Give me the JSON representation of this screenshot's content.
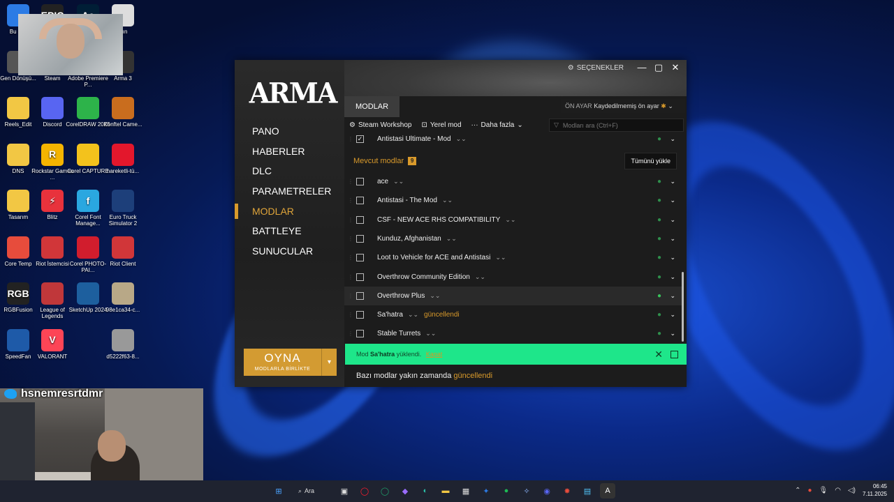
{
  "desktop": {
    "icons": [
      {
        "label": "Bu bilg",
        "color": "#2c7be5",
        "glyph": ""
      },
      {
        "label": "Gen Dönüşü...",
        "color": "#555",
        "glyph": ""
      },
      {
        "label": "Reels_Edit",
        "color": "#f2c744",
        "glyph": ""
      },
      {
        "label": "DNS",
        "color": "#f2c744",
        "glyph": ""
      },
      {
        "label": "Tasarım",
        "color": "#f2c744",
        "glyph": ""
      },
      {
        "label": "Core Temp",
        "color": "#e74c3c",
        "glyph": ""
      },
      {
        "label": "RGBFusion",
        "color": "#222",
        "glyph": "RGB"
      },
      {
        "label": "SpeedFan",
        "color": "#1e5aa8",
        "glyph": ""
      },
      {
        "label": "EPIC",
        "color": "#222",
        "glyph": "EPIC"
      },
      {
        "label": "Steam",
        "color": "#1b2838",
        "glyph": ""
      },
      {
        "label": "Discord",
        "color": "#5865f2",
        "glyph": ""
      },
      {
        "label": "Rockstar Games ...",
        "color": "#f5b400",
        "glyph": "R"
      },
      {
        "label": "Blitz",
        "color": "#e8323c",
        "glyph": "⚡"
      },
      {
        "label": "Riot İstemcisi",
        "color": "#d13639",
        "glyph": ""
      },
      {
        "label": "League of Legends",
        "color": "#c0373a",
        "glyph": ""
      },
      {
        "label": "VALORANT",
        "color": "#fd4556",
        "glyph": "V"
      },
      {
        "label": "Adobe Photosh...",
        "color": "#001e36",
        "glyph": "Ae"
      },
      {
        "label": "Adobe Premiere P...",
        "color": "#2a0a4a",
        "glyph": "Pr"
      },
      {
        "label": "CorelDRAW 2025",
        "color": "#2db34a",
        "glyph": ""
      },
      {
        "label": "Corel CAPTURE",
        "color": "#f3c21c",
        "glyph": ""
      },
      {
        "label": "Corel Font Manage...",
        "color": "#2aa7e0",
        "glyph": "f"
      },
      {
        "label": "Corel PHOTO-PAI...",
        "color": "#d11d2d",
        "glyph": ""
      },
      {
        "label": "SketchUp 2024",
        "color": "#1d5f9e",
        "glyph": ""
      },
      {
        "label": "ıyın",
        "color": "#ddd",
        "glyph": ""
      },
      {
        "label": "Arma 3",
        "color": "#333",
        "glyph": ""
      },
      {
        "label": "Konftel Came...",
        "color": "#c96d1e",
        "glyph": ""
      },
      {
        "label": "hareketli-tü...",
        "color": "#e3172c",
        "glyph": ""
      },
      {
        "label": "Euro Truck Simulator 2",
        "color": "#1d3f7a",
        "glyph": ""
      },
      {
        "label": "Riot Client",
        "color": "#d13639",
        "glyph": ""
      },
      {
        "label": "98e1ca34-c...",
        "color": "#b8a887",
        "glyph": ""
      },
      {
        "label": "d5222f63-8...",
        "color": "#999",
        "glyph": ""
      }
    ]
  },
  "stream": {
    "username": "hsnemresrtdmr"
  },
  "launcher": {
    "logo": "ARMA",
    "titlebar": {
      "settings_label": "SEÇENEKLER",
      "minimize": "—",
      "maximize": "▢",
      "close": "✕"
    },
    "nav": [
      {
        "label": "PANO",
        "active": false
      },
      {
        "label": "HABERLER",
        "active": false
      },
      {
        "label": "DLC",
        "active": false
      },
      {
        "label": "PARAMETRELER",
        "active": false
      },
      {
        "label": "MODLAR",
        "active": true
      },
      {
        "label": "BATTLEYE",
        "active": false
      },
      {
        "label": "SUNUCULAR",
        "active": false
      }
    ],
    "play": {
      "label": "OYNA",
      "sublabel": "MODLARLA BİRLİKTE"
    },
    "tab": "MODLAR",
    "preset": {
      "key": "ÖN AYAR",
      "value": "Kaydedilmemiş ön ayar"
    },
    "toolbar": {
      "steam_workshop": "Steam Workshop",
      "local_mod": "Yerel mod",
      "more": "Daha fazla",
      "search_placeholder": "Modları ara (Ctrl+F)"
    },
    "loaded_mods": [
      {
        "name": "Antistasi Ultimate - Mod",
        "checked": true
      }
    ],
    "available": {
      "title": "Mevcut modlar",
      "count": "9",
      "load_all": "Tümünü yükle",
      "mods": [
        {
          "name": "ace",
          "updated": ""
        },
        {
          "name": "Antistasi - The Mod",
          "updated": ""
        },
        {
          "name": "CSF - NEW ACE RHS COMPATIBILITY",
          "updated": ""
        },
        {
          "name": "Kunduz, Afghanistan",
          "updated": ""
        },
        {
          "name": "Loot to Vehicle for ACE and Antistasi",
          "updated": ""
        },
        {
          "name": "Overthrow Community Edition",
          "updated": ""
        },
        {
          "name": "Overthrow Plus",
          "updated": ""
        },
        {
          "name": "Sa'hatra",
          "updated": "güncellendi"
        },
        {
          "name": "Stable Turrets",
          "updated": ""
        }
      ]
    },
    "notification": {
      "prefix": "Mod",
      "mod": "Sa'hatra",
      "suffix": "yüklendi.",
      "link": "Kapat"
    },
    "footer": {
      "text": "Bazı modlar yakın zamanda",
      "highlight": "güncellendi"
    }
  },
  "taskbar": {
    "search": "Ara",
    "time": "06:45",
    "date": "7.11.2025"
  }
}
